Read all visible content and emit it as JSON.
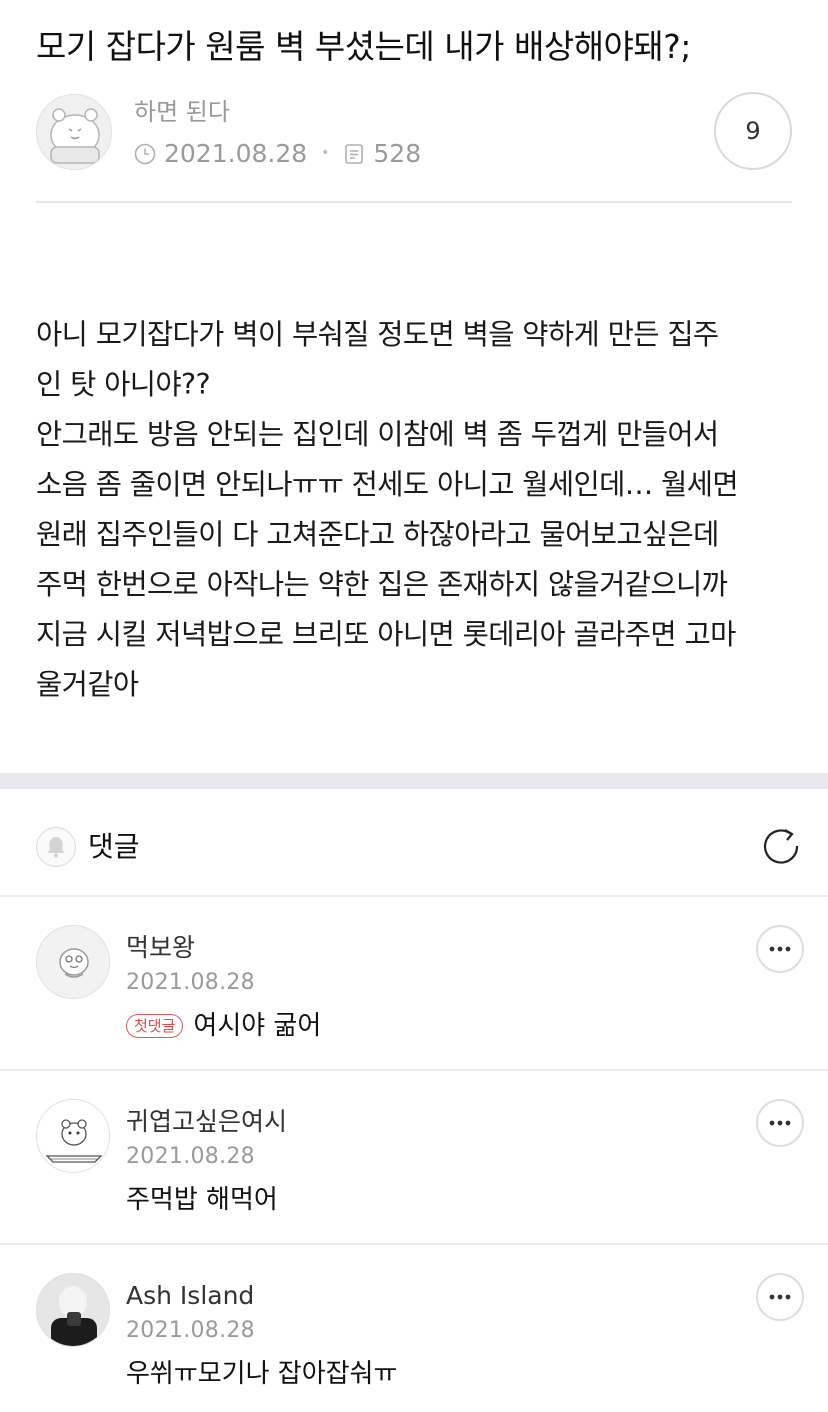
{
  "post": {
    "title": "모기 잡다가 원룸 벽 부셨는데 내가 배상해야돼?;",
    "author": "하면 된다",
    "date": "2021.08.28",
    "views": "528",
    "comment_count": "9",
    "body_lines": [
      "아니 모기잡다가 벽이 부숴질 정도면 벽을 약하게 만든 집주",
      "인 탓 아니야??",
      "안그래도 방음 안되는 집인데 이참에 벽 좀 두껍게 만들어서",
      "소음 좀 줄이면 안되나ㅠㅠ 전세도 아니고 월세인데… 월세면",
      "원래 집주인들이 다 고쳐준다고 하잖아라고 물어보고싶은데",
      "주먹 한번으로 아작나는 약한 집은 존재하지 않을거같으니까",
      "지금 시킬 저녁밥으로 브리또 아니면 롯데리아 골라주면 고마",
      "울거같아"
    ]
  },
  "comments_section": {
    "label": "댓글"
  },
  "comments": [
    {
      "name": "먹보왕",
      "date": "2021.08.28",
      "badge": "첫댓글",
      "text": "여시야 굶어"
    },
    {
      "name": "귀엽고싶은여시",
      "date": "2021.08.28",
      "text": "주먹밥 해먹어"
    },
    {
      "name": "Ash Island",
      "date": "2021.08.28",
      "text": "우쒸ㅠ모기나 잡아잡숴ㅠ"
    }
  ],
  "icons": {
    "clock": "clock-icon",
    "views": "document-icon",
    "bell": "bell-icon",
    "refresh": "refresh-icon",
    "more": "more-dots-icon"
  },
  "colors": {
    "badge_red": "#e04848",
    "muted_text": "#9a9a9a",
    "section_gap": "#e8e9ee"
  }
}
